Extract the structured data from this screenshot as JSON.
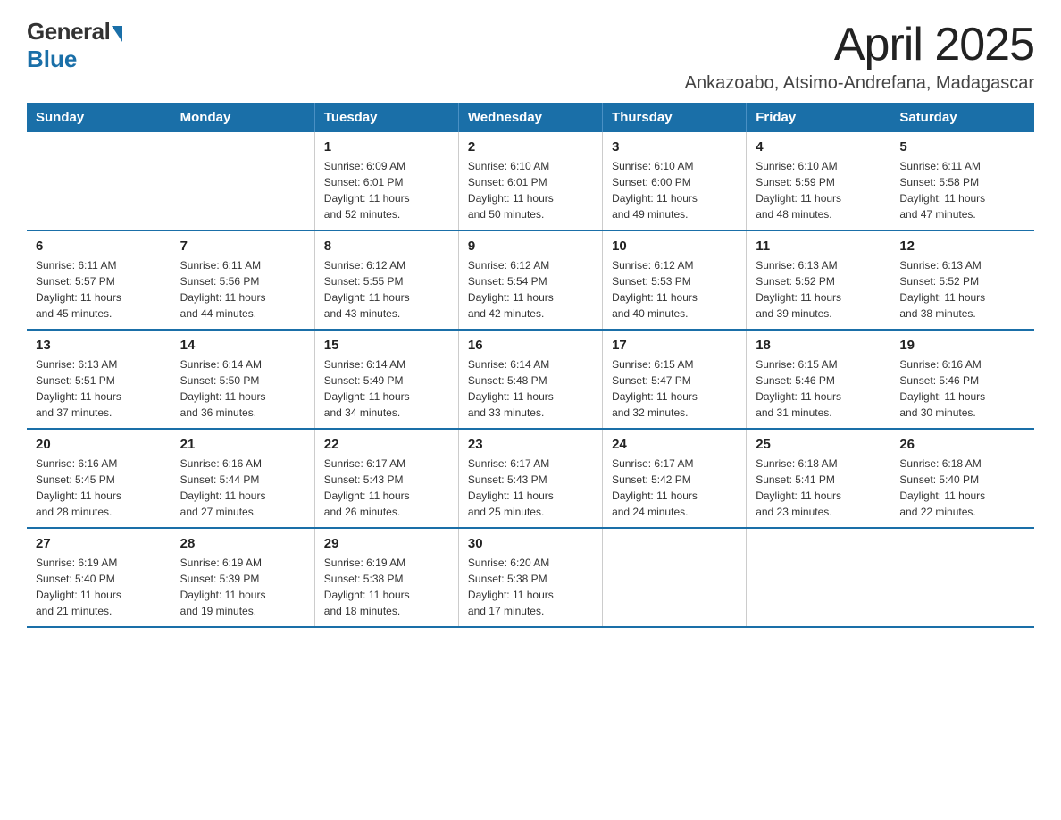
{
  "logo": {
    "general": "General",
    "blue": "Blue"
  },
  "title": "April 2025",
  "subtitle": "Ankazoabo, Atsimo-Andrefana, Madagascar",
  "days_of_week": [
    "Sunday",
    "Monday",
    "Tuesday",
    "Wednesday",
    "Thursday",
    "Friday",
    "Saturday"
  ],
  "weeks": [
    [
      {
        "day": "",
        "info": ""
      },
      {
        "day": "",
        "info": ""
      },
      {
        "day": "1",
        "info": "Sunrise: 6:09 AM\nSunset: 6:01 PM\nDaylight: 11 hours\nand 52 minutes."
      },
      {
        "day": "2",
        "info": "Sunrise: 6:10 AM\nSunset: 6:01 PM\nDaylight: 11 hours\nand 50 minutes."
      },
      {
        "day": "3",
        "info": "Sunrise: 6:10 AM\nSunset: 6:00 PM\nDaylight: 11 hours\nand 49 minutes."
      },
      {
        "day": "4",
        "info": "Sunrise: 6:10 AM\nSunset: 5:59 PM\nDaylight: 11 hours\nand 48 minutes."
      },
      {
        "day": "5",
        "info": "Sunrise: 6:11 AM\nSunset: 5:58 PM\nDaylight: 11 hours\nand 47 minutes."
      }
    ],
    [
      {
        "day": "6",
        "info": "Sunrise: 6:11 AM\nSunset: 5:57 PM\nDaylight: 11 hours\nand 45 minutes."
      },
      {
        "day": "7",
        "info": "Sunrise: 6:11 AM\nSunset: 5:56 PM\nDaylight: 11 hours\nand 44 minutes."
      },
      {
        "day": "8",
        "info": "Sunrise: 6:12 AM\nSunset: 5:55 PM\nDaylight: 11 hours\nand 43 minutes."
      },
      {
        "day": "9",
        "info": "Sunrise: 6:12 AM\nSunset: 5:54 PM\nDaylight: 11 hours\nand 42 minutes."
      },
      {
        "day": "10",
        "info": "Sunrise: 6:12 AM\nSunset: 5:53 PM\nDaylight: 11 hours\nand 40 minutes."
      },
      {
        "day": "11",
        "info": "Sunrise: 6:13 AM\nSunset: 5:52 PM\nDaylight: 11 hours\nand 39 minutes."
      },
      {
        "day": "12",
        "info": "Sunrise: 6:13 AM\nSunset: 5:52 PM\nDaylight: 11 hours\nand 38 minutes."
      }
    ],
    [
      {
        "day": "13",
        "info": "Sunrise: 6:13 AM\nSunset: 5:51 PM\nDaylight: 11 hours\nand 37 minutes."
      },
      {
        "day": "14",
        "info": "Sunrise: 6:14 AM\nSunset: 5:50 PM\nDaylight: 11 hours\nand 36 minutes."
      },
      {
        "day": "15",
        "info": "Sunrise: 6:14 AM\nSunset: 5:49 PM\nDaylight: 11 hours\nand 34 minutes."
      },
      {
        "day": "16",
        "info": "Sunrise: 6:14 AM\nSunset: 5:48 PM\nDaylight: 11 hours\nand 33 minutes."
      },
      {
        "day": "17",
        "info": "Sunrise: 6:15 AM\nSunset: 5:47 PM\nDaylight: 11 hours\nand 32 minutes."
      },
      {
        "day": "18",
        "info": "Sunrise: 6:15 AM\nSunset: 5:46 PM\nDaylight: 11 hours\nand 31 minutes."
      },
      {
        "day": "19",
        "info": "Sunrise: 6:16 AM\nSunset: 5:46 PM\nDaylight: 11 hours\nand 30 minutes."
      }
    ],
    [
      {
        "day": "20",
        "info": "Sunrise: 6:16 AM\nSunset: 5:45 PM\nDaylight: 11 hours\nand 28 minutes."
      },
      {
        "day": "21",
        "info": "Sunrise: 6:16 AM\nSunset: 5:44 PM\nDaylight: 11 hours\nand 27 minutes."
      },
      {
        "day": "22",
        "info": "Sunrise: 6:17 AM\nSunset: 5:43 PM\nDaylight: 11 hours\nand 26 minutes."
      },
      {
        "day": "23",
        "info": "Sunrise: 6:17 AM\nSunset: 5:43 PM\nDaylight: 11 hours\nand 25 minutes."
      },
      {
        "day": "24",
        "info": "Sunrise: 6:17 AM\nSunset: 5:42 PM\nDaylight: 11 hours\nand 24 minutes."
      },
      {
        "day": "25",
        "info": "Sunrise: 6:18 AM\nSunset: 5:41 PM\nDaylight: 11 hours\nand 23 minutes."
      },
      {
        "day": "26",
        "info": "Sunrise: 6:18 AM\nSunset: 5:40 PM\nDaylight: 11 hours\nand 22 minutes."
      }
    ],
    [
      {
        "day": "27",
        "info": "Sunrise: 6:19 AM\nSunset: 5:40 PM\nDaylight: 11 hours\nand 21 minutes."
      },
      {
        "day": "28",
        "info": "Sunrise: 6:19 AM\nSunset: 5:39 PM\nDaylight: 11 hours\nand 19 minutes."
      },
      {
        "day": "29",
        "info": "Sunrise: 6:19 AM\nSunset: 5:38 PM\nDaylight: 11 hours\nand 18 minutes."
      },
      {
        "day": "30",
        "info": "Sunrise: 6:20 AM\nSunset: 5:38 PM\nDaylight: 11 hours\nand 17 minutes."
      },
      {
        "day": "",
        "info": ""
      },
      {
        "day": "",
        "info": ""
      },
      {
        "day": "",
        "info": ""
      }
    ]
  ]
}
